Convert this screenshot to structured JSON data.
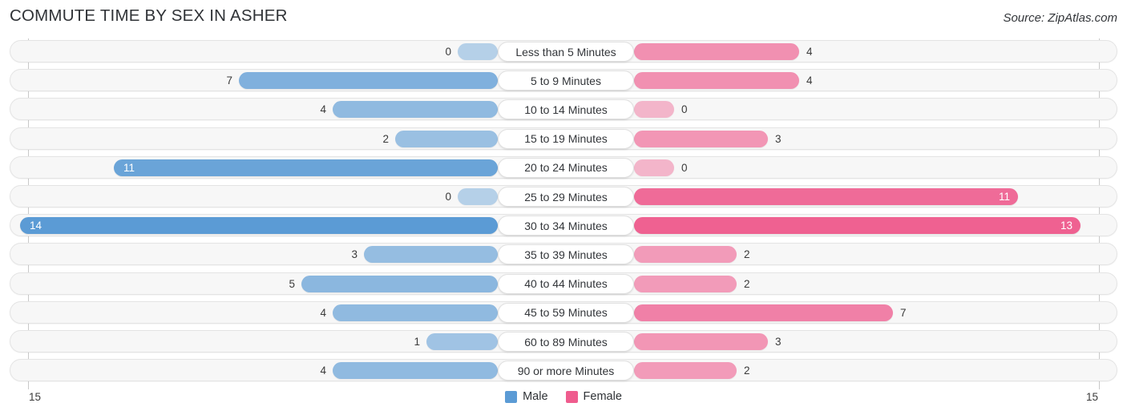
{
  "header": {
    "title": "COMMUTE TIME BY SEX IN ASHER",
    "source": "Source: ZipAtlas.com"
  },
  "axis": {
    "left_tick": "15",
    "right_tick": "15"
  },
  "legend": {
    "male_label": "Male",
    "female_label": "Female",
    "male_color": "#5b9bd5",
    "female_color": "#ef5c8e"
  },
  "chart_data": {
    "type": "bar",
    "subtype": "diverging-bidirectional",
    "title": "COMMUTE TIME BY SEX IN ASHER",
    "xlabel": "",
    "ylabel": "",
    "xlim": [
      15,
      15
    ],
    "axis_max": 15,
    "grid": false,
    "legend_position": "bottom-center",
    "categories": [
      "Less than 5 Minutes",
      "5 to 9 Minutes",
      "10 to 14 Minutes",
      "15 to 19 Minutes",
      "20 to 24 Minutes",
      "25 to 29 Minutes",
      "30 to 34 Minutes",
      "35 to 39 Minutes",
      "40 to 44 Minutes",
      "45 to 59 Minutes",
      "60 to 89 Minutes",
      "90 or more Minutes"
    ],
    "series": [
      {
        "name": "Male",
        "direction": "left",
        "color": "#5b9bd5",
        "values": [
          0,
          7,
          4,
          2,
          11,
          0,
          14,
          3,
          5,
          4,
          1,
          4
        ]
      },
      {
        "name": "Female",
        "direction": "right",
        "color": "#ef5c8e",
        "values": [
          4,
          4,
          0,
          3,
          0,
          11,
          13,
          2,
          2,
          7,
          3,
          2
        ]
      }
    ]
  }
}
